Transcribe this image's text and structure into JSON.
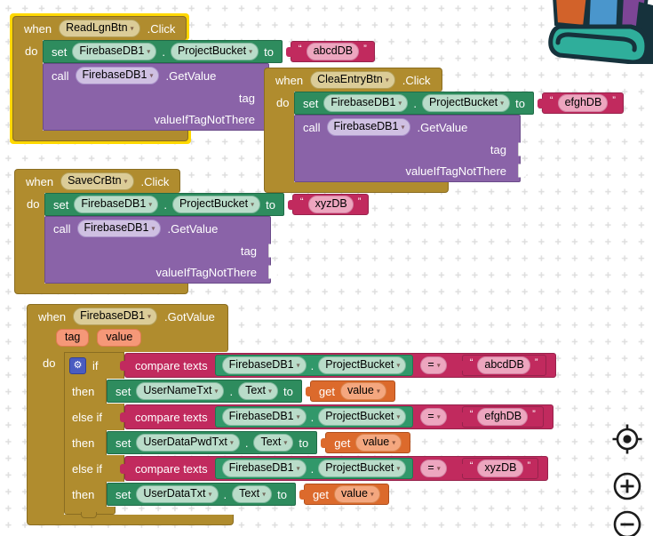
{
  "labels": {
    "when": "when",
    "do": "do",
    "set": "set",
    "call": "call",
    "to": "to",
    "dot": ".",
    "if": "if",
    "then": "then",
    "else_if": "else if",
    "get": "get",
    "compare": "compare texts",
    "click": ".Click",
    "getvalue": ".GetValue",
    "gotvalue": ".GotValue"
  },
  "icons": {
    "caret": "▾",
    "gear": "⚙",
    "quote_open": "“",
    "quote_close": "”",
    "backpack": "backpack",
    "center_target": "⌖",
    "zoom_in": "+",
    "zoom_out": "−"
  },
  "palette": {
    "gold": "#b08c2e",
    "selected_halo": "#ffd800",
    "setter_green": "#2e8c5e",
    "getter_green": "#31986a",
    "method_purple": "#8a63a8",
    "text_magenta": "#c12a5e",
    "variable_orange": "#dc6a2c",
    "param_chip": "#f59878",
    "gear_blue": "#4a5cc0",
    "backpack_teal": "#2fae9b",
    "dot_grid": "#dedede"
  },
  "blocks": {
    "read_lgn": {
      "button": "ReadLgnBtn",
      "db": "FirebaseDB1",
      "property": "ProjectBucket",
      "value": "abcdDB",
      "params": [
        "tag",
        "valueIfTagNotThere"
      ]
    },
    "clea_entry": {
      "button": "CleaEntryBtn",
      "db": "FirebaseDB1",
      "property": "ProjectBucket",
      "value": "efghDB",
      "params": [
        "tag",
        "valueIfTagNotThere"
      ]
    },
    "save_cr": {
      "button": "SaveCrBtn",
      "db": "FirebaseDB1",
      "property": "ProjectBucket",
      "value": "xyzDB",
      "params": [
        "tag",
        "valueIfTagNotThere"
      ]
    },
    "got_value": {
      "db": "FirebaseDB1",
      "params": [
        "tag",
        "value"
      ],
      "branches": [
        {
          "db": "FirebaseDB1",
          "property": "ProjectBucket",
          "op": "=",
          "value": "abcdDB",
          "target": "UserNameTxt",
          "target_prop": "Text",
          "var": "value"
        },
        {
          "db": "FirebaseDB1",
          "property": "ProjectBucket",
          "op": "=",
          "value": "efghDB",
          "target": "UserDataPwdTxt",
          "target_prop": "Text",
          "var": "value"
        },
        {
          "db": "FirebaseDB1",
          "property": "ProjectBucket",
          "op": "=",
          "value": "xyzDB",
          "target": "UserDataTxt",
          "target_prop": "Text",
          "var": "value"
        }
      ]
    }
  }
}
